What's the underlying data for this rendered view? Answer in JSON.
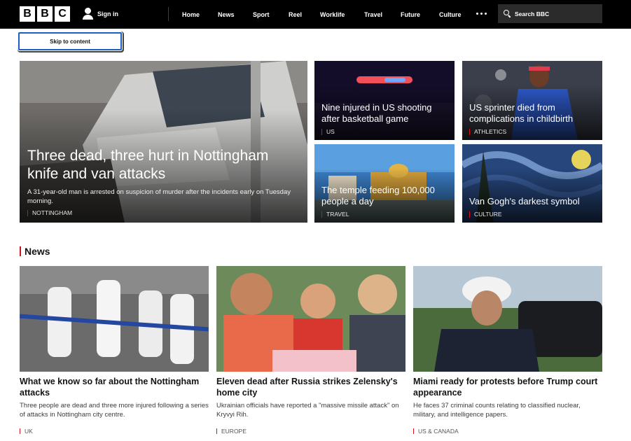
{
  "brand": {
    "logo_letters": [
      "B",
      "B",
      "C"
    ],
    "colors": {
      "accent": "#d80f23",
      "nav_bg": "#000000"
    }
  },
  "header": {
    "signin_label": "Sign in",
    "nav_items": [
      "Home",
      "News",
      "Sport",
      "Reel",
      "Worklife",
      "Travel",
      "Future",
      "Culture"
    ],
    "more_icon": "more-dots-icon",
    "search_placeholder": "Search BBC"
  },
  "skip_link": "Skip to content",
  "hero": {
    "main": {
      "headline": "Three dead, three hurt in Nottingham knife and van attacks",
      "summary": "A 31-year-old man is arrested on suspicion of murder after the incidents early on Tuesday morning.",
      "tag": "NOTTINGHAM"
    },
    "tiles": [
      {
        "headline": "Nine injured in US shooting after basketball game",
        "tag": "US"
      },
      {
        "headline": "US sprinter died from complications in childbirth",
        "tag": "ATHLETICS"
      },
      {
        "headline": "The temple feeding 100,000 people a day",
        "tag": "TRAVEL"
      },
      {
        "headline": "Van Gogh's darkest symbol",
        "tag": "CULTURE"
      }
    ]
  },
  "news": {
    "section_title": "News",
    "cards": [
      {
        "headline": "What we know so far about the Nottingham attacks",
        "summary": "Three people are dead and three more injured following a series of attacks in Nottingham city centre.",
        "tag": "UK"
      },
      {
        "headline": "Eleven dead after Russia strikes Zelensky's home city",
        "summary": "Ukrainian officials have reported a \"massive missile attack\" on Kryvyi Rih.",
        "tag": "EUROPE"
      },
      {
        "headline": "Miami ready for protests before Trump court appearance",
        "summary": "He faces 37 criminal counts relating to classified nuclear, military, and intelligence papers.",
        "tag": "US & CANADA"
      }
    ]
  }
}
